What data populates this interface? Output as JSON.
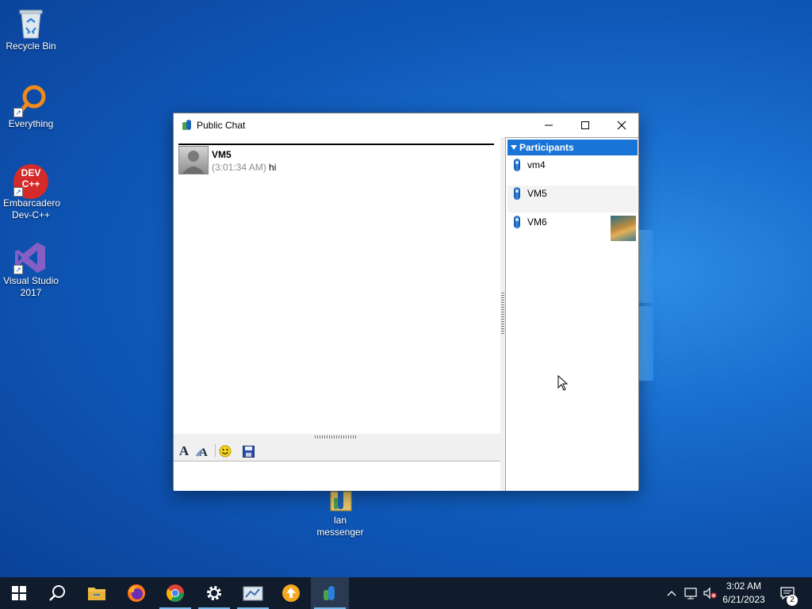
{
  "desktop": {
    "icons": [
      {
        "label": "Recycle Bin"
      },
      {
        "label": "Everything"
      },
      {
        "label": "Embarcadero Dev-C++"
      },
      {
        "label": "Visual Studio 2017"
      },
      {
        "label": "lan messenger"
      }
    ],
    "devcpp_logo_text": "DEV C++"
  },
  "window": {
    "title": "Public Chat",
    "controls": {
      "minimize": "minimize-icon",
      "maximize": "maximize-icon",
      "close": "close-icon"
    },
    "messages": [
      {
        "sender": "VM5",
        "time": "(3:01:34 AM)",
        "text": "hi"
      }
    ],
    "toolbar": [
      "font-icon",
      "font-color-icon",
      "smiley-icon",
      "save-icon"
    ],
    "input_value": ""
  },
  "participants": {
    "header": "Participants",
    "items": [
      {
        "name": "vm4",
        "has_avatar": false
      },
      {
        "name": "VM5",
        "has_avatar": false
      },
      {
        "name": "VM6",
        "has_avatar": true
      }
    ]
  },
  "taskbar": {
    "items": [
      "start-icon",
      "search-icon",
      "file-explorer-icon",
      "firefox-icon",
      "chrome-icon",
      "settings-icon",
      "app-icon",
      "upload-app-icon",
      "lan-messenger-icon"
    ],
    "clock": {
      "time": "3:02 AM",
      "date": "6/21/2023"
    },
    "notification_count": "2"
  },
  "colors": {
    "accent": "#1874d6",
    "taskbar": "#101c2c",
    "desktop": "#0f58b8"
  }
}
